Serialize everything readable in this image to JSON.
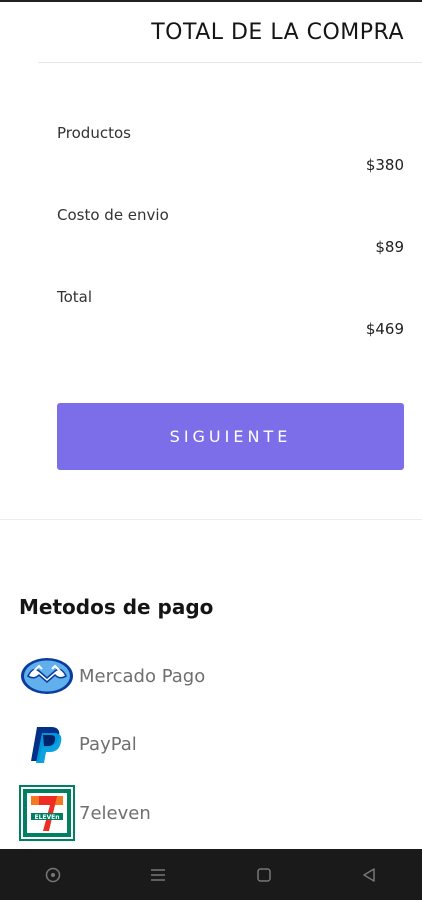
{
  "header": {
    "title": "TOTAL DE LA COMPRA"
  },
  "summary": {
    "rows": [
      {
        "label": "Productos",
        "value": "$380"
      },
      {
        "label": "Costo de envio",
        "value": "$89"
      },
      {
        "label": "Total",
        "value": "$469"
      }
    ]
  },
  "actions": {
    "next_label": "SIGUIENTE"
  },
  "payment": {
    "title": "Metodos de pago",
    "methods": [
      {
        "label": "Mercado Pago",
        "icon": "mercado-pago-logo"
      },
      {
        "label": "PayPal",
        "icon": "paypal-logo"
      },
      {
        "label": "7eleven",
        "icon": "seven-eleven-logo"
      }
    ]
  },
  "navbar": {
    "buttons": [
      "circle-icon",
      "menu-icon",
      "home-square-icon",
      "back-triangle-icon"
    ]
  },
  "colors": {
    "accent": "#7b6ee8",
    "navbar": "#1a1a1a",
    "mercado_pago_blue": "#0a3c9e",
    "paypal_dark": "#003087",
    "paypal_light": "#009cde",
    "seven_eleven_green": "#008061",
    "seven_eleven_orange": "#f47920",
    "seven_eleven_red": "#ee2d24"
  }
}
